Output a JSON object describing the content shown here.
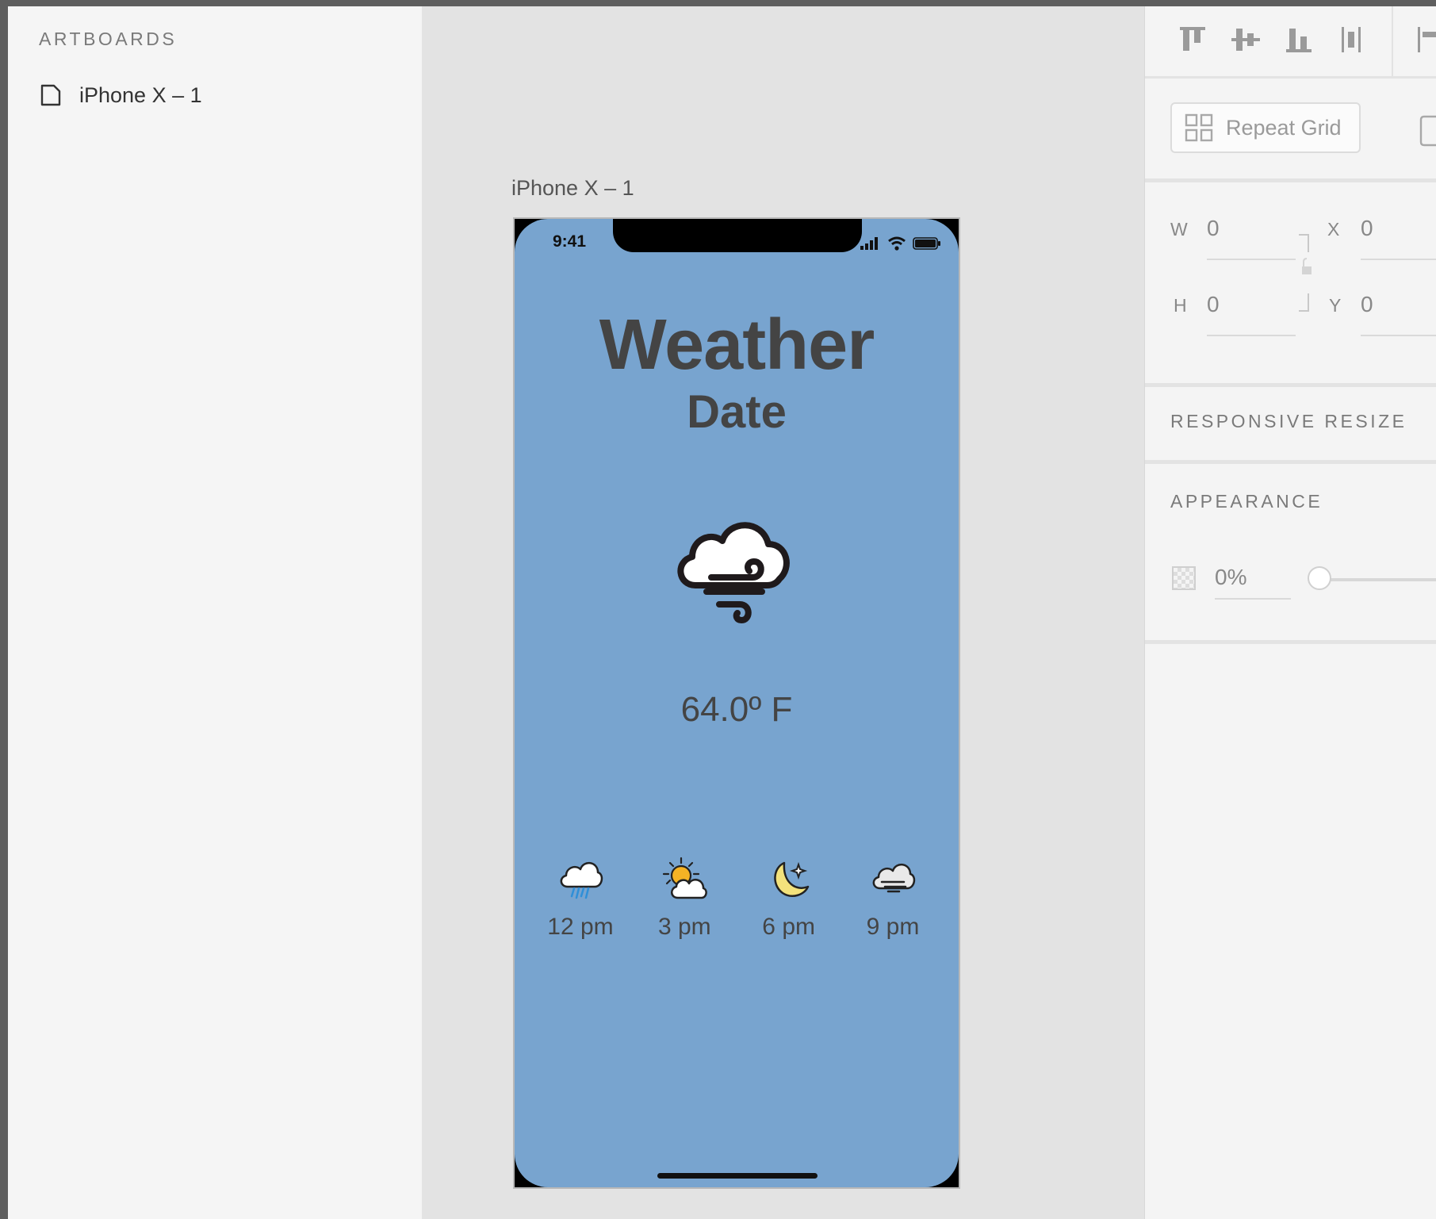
{
  "layers": {
    "heading": "ARTBOARDS",
    "items": [
      {
        "label": "iPhone X – 1",
        "icon": "document-icon"
      }
    ]
  },
  "canvas": {
    "artboard_title": "iPhone X – 1",
    "phone": {
      "status_time": "9:41",
      "background": "#78a4cf",
      "title": "Weather",
      "date": "Date",
      "main_icon": "cloud-wind-icon",
      "temperature": "64.0º F",
      "hourly": [
        {
          "label": "12 pm",
          "icon": "rain-cloud-icon"
        },
        {
          "label": "3 pm",
          "icon": "partly-sunny-icon"
        },
        {
          "label": "6 pm",
          "icon": "moon-star-icon"
        },
        {
          "label": "9 pm",
          "icon": "windy-cloud-icon"
        }
      ]
    }
  },
  "inspector": {
    "repeat_grid_label": "Repeat Grid",
    "w_label": "W",
    "w_value": "0",
    "h_label": "H",
    "h_value": "0",
    "x_label": "X",
    "x_value": "0",
    "y_label": "Y",
    "y_value": "0",
    "responsive_resize": "RESPONSIVE RESIZE",
    "appearance": "APPEARANCE",
    "opacity_value": "0%",
    "opacity_level": 0
  }
}
